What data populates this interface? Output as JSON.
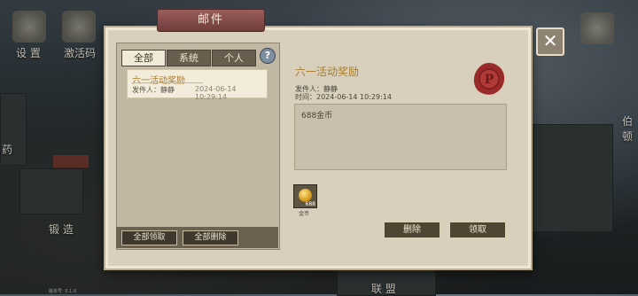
{
  "window": {
    "title": "邮件"
  },
  "hud": {
    "settings_label": "设 置",
    "activation_label": "激活码",
    "pharmacy_label": "药",
    "forge_label": "锻 造",
    "alliance_label": "联 盟",
    "right_label": "伯顿"
  },
  "tabs": [
    {
      "label": "全部",
      "active": true
    },
    {
      "label": "系统",
      "active": false
    },
    {
      "label": "个人",
      "active": false
    }
  ],
  "help_label": "?",
  "mail_list": [
    {
      "title": "六一活动奖励",
      "sender": "发件人：静静",
      "time": "2024-06-14 10:29:14"
    }
  ],
  "left_buttons": {
    "claim_all": "全部领取",
    "delete_all": "全部删除"
  },
  "mail": {
    "title": "六一活动奖励",
    "sender_line": "发件人：静静",
    "time_line": "时间：2024-06-14 10:29:14",
    "content": "688金币",
    "reward": {
      "name": "金币",
      "count": "688",
      "icon": "gold-coin-icon"
    }
  },
  "actions": {
    "delete": "删除",
    "claim": "领取"
  },
  "close_label": "✕",
  "version_text": "版本号: 0.1.0",
  "colors": {
    "accent_gold": "#a97d30",
    "seal_red": "#9b2a2a",
    "panel_bg": "#d8d0bd"
  }
}
